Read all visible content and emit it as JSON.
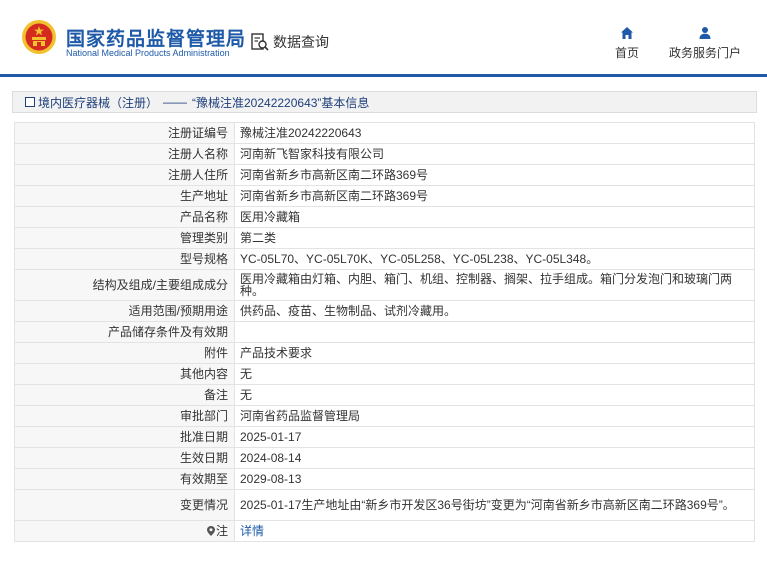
{
  "header": {
    "brand_cn": "国家药品监督管理局",
    "brand_en": "National Medical Products Administration",
    "query_label": "数据查询",
    "nav_home": "首页",
    "nav_portal": "政务服务门户"
  },
  "breadcrumb": {
    "category": "境内医疗器械（注册）",
    "separator": "——",
    "title": "“豫械注准20242220643”基本信息"
  },
  "details": {
    "reg_no": {
      "label": "注册证编号",
      "value": "豫械注准20242220643"
    },
    "registrant": {
      "label": "注册人名称",
      "value": "河南新飞智家科技有限公司"
    },
    "reg_address": {
      "label": "注册人住所",
      "value": "河南省新乡市高新区南二环路369号"
    },
    "prod_address": {
      "label": "生产地址",
      "value": "河南省新乡市高新区南二环路369号"
    },
    "product_name": {
      "label": "产品名称",
      "value": "医用冷藏箱"
    },
    "class": {
      "label": "管理类别",
      "value": "第二类"
    },
    "models": {
      "label": "型号规格",
      "value": "YC-05L70、YC-05L70K、YC-05L258、YC-05L238、YC-05L348。"
    },
    "structure": {
      "label": "结构及组成/主要组成成分",
      "value": "医用冷藏箱由灯箱、内胆、箱门、机组、控制器、搁架、拉手组成。箱门分发泡门和玻璃门两种。"
    },
    "scope": {
      "label": "适用范围/预期用途",
      "value": "供药品、疫苗、生物制品、试剂冷藏用。"
    },
    "storage": {
      "label": "产品储存条件及有效期",
      "value": ""
    },
    "attachment": {
      "label": "附件",
      "value": "产品技术要求"
    },
    "other": {
      "label": "其他内容",
      "value": "无"
    },
    "remark": {
      "label": "备注",
      "value": "无"
    },
    "dept": {
      "label": "审批部门",
      "value": "河南省药品监督管理局"
    },
    "approve_date": {
      "label": "批准日期",
      "value": "2025-01-17"
    },
    "effective": {
      "label": "生效日期",
      "value": "2024-08-14"
    },
    "expiry": {
      "label": "有效期至",
      "value": "2029-08-13"
    },
    "change": {
      "label": "变更情况",
      "value": "2025-01-17生产地址由“新乡市开发区36号街坊”变更为“河南省新乡市高新区南二环路369号”。"
    },
    "note": {
      "label": "注",
      "value": "详情"
    }
  },
  "colors": {
    "brand_blue": "#1e5aa8",
    "emblem_red": "#d42a1f",
    "emblem_gold": "#f2c12e"
  },
  "icons": [
    "emblem-logo",
    "search-document-icon",
    "home-icon",
    "user-icon",
    "square-icon",
    "pin-icon"
  ]
}
